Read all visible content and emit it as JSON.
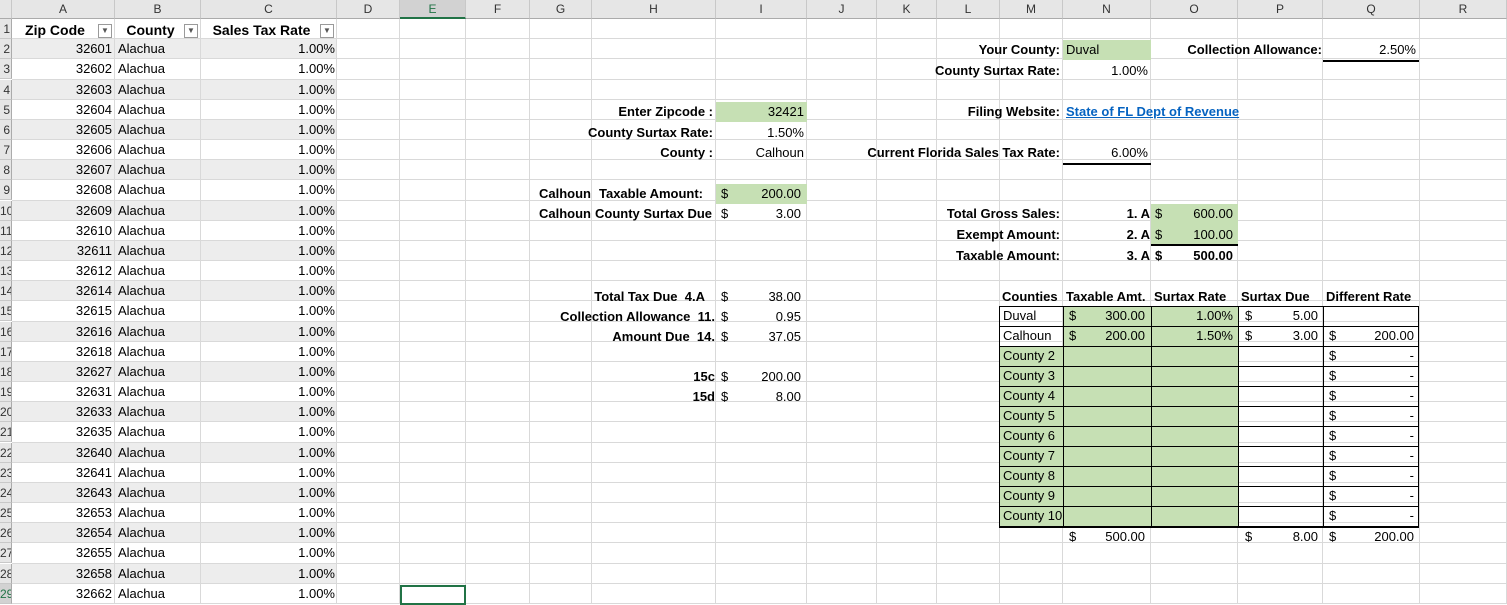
{
  "columns": [
    "A",
    "B",
    "C",
    "D",
    "E",
    "F",
    "G",
    "H",
    "I",
    "J",
    "K",
    "L",
    "M",
    "N",
    "O",
    "P",
    "Q",
    "R"
  ],
  "row_numbers": [
    "1",
    "2",
    "3",
    "4",
    "5",
    "6",
    "7",
    "8",
    "9",
    "10",
    "11",
    "12",
    "13",
    "14",
    "15",
    "16",
    "17",
    "18",
    "19",
    "20",
    "21",
    "22",
    "23",
    "24",
    "25",
    "26",
    "27",
    "28",
    "29"
  ],
  "table": {
    "headers": {
      "zip": "Zip Code",
      "county": "County",
      "rate": "Sales Tax Rate"
    },
    "rows": [
      {
        "zip": "32601",
        "county": "Alachua",
        "rate": "1.00%"
      },
      {
        "zip": "32602",
        "county": "Alachua",
        "rate": "1.00%"
      },
      {
        "zip": "32603",
        "county": "Alachua",
        "rate": "1.00%"
      },
      {
        "zip": "32604",
        "county": "Alachua",
        "rate": "1.00%"
      },
      {
        "zip": "32605",
        "county": "Alachua",
        "rate": "1.00%"
      },
      {
        "zip": "32606",
        "county": "Alachua",
        "rate": "1.00%"
      },
      {
        "zip": "32607",
        "county": "Alachua",
        "rate": "1.00%"
      },
      {
        "zip": "32608",
        "county": "Alachua",
        "rate": "1.00%"
      },
      {
        "zip": "32609",
        "county": "Alachua",
        "rate": "1.00%"
      },
      {
        "zip": "32610",
        "county": "Alachua",
        "rate": "1.00%"
      },
      {
        "zip": "32611",
        "county": "Alachua",
        "rate": "1.00%"
      },
      {
        "zip": "32612",
        "county": "Alachua",
        "rate": "1.00%"
      },
      {
        "zip": "32614",
        "county": "Alachua",
        "rate": "1.00%"
      },
      {
        "zip": "32615",
        "county": "Alachua",
        "rate": "1.00%"
      },
      {
        "zip": "32616",
        "county": "Alachua",
        "rate": "1.00%"
      },
      {
        "zip": "32618",
        "county": "Alachua",
        "rate": "1.00%"
      },
      {
        "zip": "32627",
        "county": "Alachua",
        "rate": "1.00%"
      },
      {
        "zip": "32631",
        "county": "Alachua",
        "rate": "1.00%"
      },
      {
        "zip": "32633",
        "county": "Alachua",
        "rate": "1.00%"
      },
      {
        "zip": "32635",
        "county": "Alachua",
        "rate": "1.00%"
      },
      {
        "zip": "32640",
        "county": "Alachua",
        "rate": "1.00%"
      },
      {
        "zip": "32641",
        "county": "Alachua",
        "rate": "1.00%"
      },
      {
        "zip": "32643",
        "county": "Alachua",
        "rate": "1.00%"
      },
      {
        "zip": "32653",
        "county": "Alachua",
        "rate": "1.00%"
      },
      {
        "zip": "32654",
        "county": "Alachua",
        "rate": "1.00%"
      },
      {
        "zip": "32655",
        "county": "Alachua",
        "rate": "1.00%"
      },
      {
        "zip": "32658",
        "county": "Alachua",
        "rate": "1.00%"
      },
      {
        "zip": "32662",
        "county": "Alachua",
        "rate": "1.00%"
      }
    ]
  },
  "lookup": {
    "enter_zip_label": "Enter Zipcode :",
    "enter_zip_value": "32421",
    "surtax_label": "County Surtax Rate:",
    "surtax_value": "1.50%",
    "county_label": "County :",
    "county_value": "Calhoun",
    "taxable_county": "Calhoun",
    "taxable_label": "Taxable Amount:",
    "taxable_cur": "$",
    "taxable_value": "200.00",
    "due_county": "Calhoun",
    "due_label": "County Surtax Due",
    "due_cur": "$",
    "due_value": "3.00"
  },
  "summary": {
    "total_label": "Total Tax Due",
    "total_line": "4.A",
    "total_cur": "$",
    "total_value": "38.00",
    "allow_label": "Collection Allowance",
    "allow_line": "11.",
    "allow_cur": "$",
    "allow_value": "0.95",
    "amount_label": "Amount Due",
    "amount_line": "14.",
    "amount_cur": "$",
    "amount_value": "37.05",
    "l15c": "15c",
    "l15c_cur": "$",
    "l15c_value": "200.00",
    "l15d": "15d",
    "l15d_cur": "$",
    "l15d_value": "8.00"
  },
  "settings": {
    "your_county_label": "Your County:",
    "your_county_value": "Duval",
    "county_surtax_label": "County Surtax Rate:",
    "county_surtax_value": "1.00%",
    "allowance_label": "Collection Allowance:",
    "allowance_value": "2.50%",
    "filing_label": "Filing Website:",
    "filing_link": "State of FL Dept of Revenue",
    "fl_rate_label": "Current Florida Sales Tax Rate:",
    "fl_rate_value": "6.00%"
  },
  "gross": {
    "gross_label": "Total Gross Sales:",
    "gross_line": "1. A",
    "gross_cur": "$",
    "gross_value": "600.00",
    "exempt_label": "Exempt Amount:",
    "exempt_line": "2. A",
    "exempt_cur": "$",
    "exempt_value": "100.00",
    "taxable_label": "Taxable Amount:",
    "taxable_line": "3. A",
    "taxable_cur": "$",
    "taxable_value": "500.00"
  },
  "counties": {
    "headers": {
      "county": "Counties",
      "taxable": "Taxable Amt.",
      "rate": "Surtax Rate",
      "due": "Surtax Due",
      "diff": "Different Rate"
    },
    "rows": [
      {
        "name": "Duval",
        "cur": "$",
        "taxable": "300.00",
        "rate": "1.00%",
        "due_cur": "$",
        "due": "5.00",
        "diff_cur": "",
        "diff": ""
      },
      {
        "name": "Calhoun",
        "cur": "$",
        "taxable": "200.00",
        "rate": "1.50%",
        "due_cur": "$",
        "due": "3.00",
        "diff_cur": "$",
        "diff": "200.00"
      },
      {
        "name": "County 2",
        "cur": "",
        "taxable": "",
        "rate": "",
        "due_cur": "",
        "due": "",
        "diff_cur": "$",
        "diff": "-"
      },
      {
        "name": "County 3",
        "cur": "",
        "taxable": "",
        "rate": "",
        "due_cur": "",
        "due": "",
        "diff_cur": "$",
        "diff": "-"
      },
      {
        "name": "County 4",
        "cur": "",
        "taxable": "",
        "rate": "",
        "due_cur": "",
        "due": "",
        "diff_cur": "$",
        "diff": "-"
      },
      {
        "name": "County 5",
        "cur": "",
        "taxable": "",
        "rate": "",
        "due_cur": "",
        "due": "",
        "diff_cur": "$",
        "diff": "-"
      },
      {
        "name": "County 6",
        "cur": "",
        "taxable": "",
        "rate": "",
        "due_cur": "",
        "due": "",
        "diff_cur": "$",
        "diff": "-"
      },
      {
        "name": "County 7",
        "cur": "",
        "taxable": "",
        "rate": "",
        "due_cur": "",
        "due": "",
        "diff_cur": "$",
        "diff": "-"
      },
      {
        "name": "County 8",
        "cur": "",
        "taxable": "",
        "rate": "",
        "due_cur": "",
        "due": "",
        "diff_cur": "$",
        "diff": "-"
      },
      {
        "name": "County 9",
        "cur": "",
        "taxable": "",
        "rate": "",
        "due_cur": "",
        "due": "",
        "diff_cur": "$",
        "diff": "-"
      },
      {
        "name": "County 10",
        "cur": "",
        "taxable": "",
        "rate": "",
        "due_cur": "",
        "due": "",
        "diff_cur": "$",
        "diff": "-"
      }
    ],
    "totals": {
      "cur": "$",
      "taxable": "500.00",
      "due_cur": "$",
      "due": "8.00",
      "diff_cur": "$",
      "diff": "200.00"
    }
  },
  "icons": {
    "filter": "filter-dropdown-icon",
    "sorted_filter": "sort-filter-icon"
  },
  "colors": {
    "input_fill": "#c6e0b4",
    "link": "#0563c1",
    "selection": "#217346"
  }
}
